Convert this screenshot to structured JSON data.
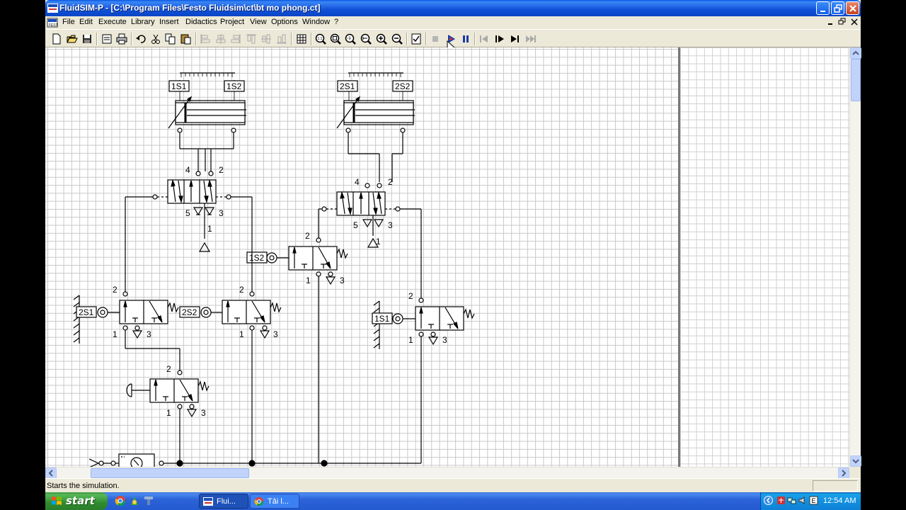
{
  "window": {
    "title": "FluidSIM-P - [C:\\Program Files\\Festo Fluidsim\\ct\\bt mo phong.ct]"
  },
  "menu": [
    {
      "label": "File",
      "name": "menu-file"
    },
    {
      "label": "Edit",
      "name": "menu-edit"
    },
    {
      "label": "Execute",
      "name": "menu-execute"
    },
    {
      "label": "Library",
      "name": "menu-library"
    },
    {
      "label": "Insert",
      "name": "menu-insert"
    },
    {
      "label": "Didactics",
      "name": "menu-didactics"
    },
    {
      "label": "Project",
      "name": "menu-project"
    },
    {
      "label": "View",
      "name": "menu-view"
    },
    {
      "label": "Options",
      "name": "menu-options"
    },
    {
      "label": "Window",
      "name": "menu-window"
    },
    {
      "label": "?",
      "name": "menu-help"
    }
  ],
  "toolbar": {
    "buttons": [
      "new",
      "open",
      "save",
      "print-preview",
      "print",
      "undo",
      "cut",
      "copy",
      "paste",
      "align-left",
      "align-center-h",
      "align-right",
      "align-top",
      "align-middle",
      "align-bottom",
      "grid",
      "zoom-1to1",
      "zoom-circuit",
      "zoom-window",
      "zoom-in",
      "zoom-out",
      "check",
      "stop",
      "start-simulation",
      "pause",
      "reset",
      "step",
      "simulate-to-state-change"
    ]
  },
  "circuit_labels": {
    "cyl1_s1": "1S1",
    "cyl1_s2": "1S2",
    "cyl2_s1": "2S1",
    "cyl2_s2": "2S2",
    "v1_port4": "4",
    "v1_port2": "2",
    "v1_port5": "5",
    "v1_port3": "3",
    "v1_port1": "1",
    "v2_port4": "4",
    "v2_port2": "2",
    "v2_port5": "5",
    "v2_port3": "3",
    "v2_port1": "1",
    "lim_1s2_tag": "1S2",
    "lim_1s2_p2": "2",
    "lim_1s2_p1": "1",
    "lim_1s2_p3": "3",
    "lim_2s1_tag": "2S1",
    "lim_2s1_p2": "2",
    "lim_2s1_p1": "1",
    "lim_2s1_p3": "3",
    "lim_2s2_tag": "2S2",
    "lim_2s2_p2": "2",
    "lim_2s2_p1": "1",
    "lim_2s2_p3": "3",
    "lim_1s1_tag": "1S1",
    "lim_1s1_p2": "2",
    "lim_1s1_p1": "1",
    "lim_1s1_p3": "3",
    "push_p2": "2",
    "push_p1": "1",
    "push_p3": "3"
  },
  "status": {
    "message": "Starts the simulation."
  },
  "taskbar": {
    "start_label": "start",
    "tasks": [
      {
        "label": "Flui...",
        "active": true
      },
      {
        "label": "Tải l...",
        "active": false
      }
    ],
    "clock": "12:54 AM"
  }
}
